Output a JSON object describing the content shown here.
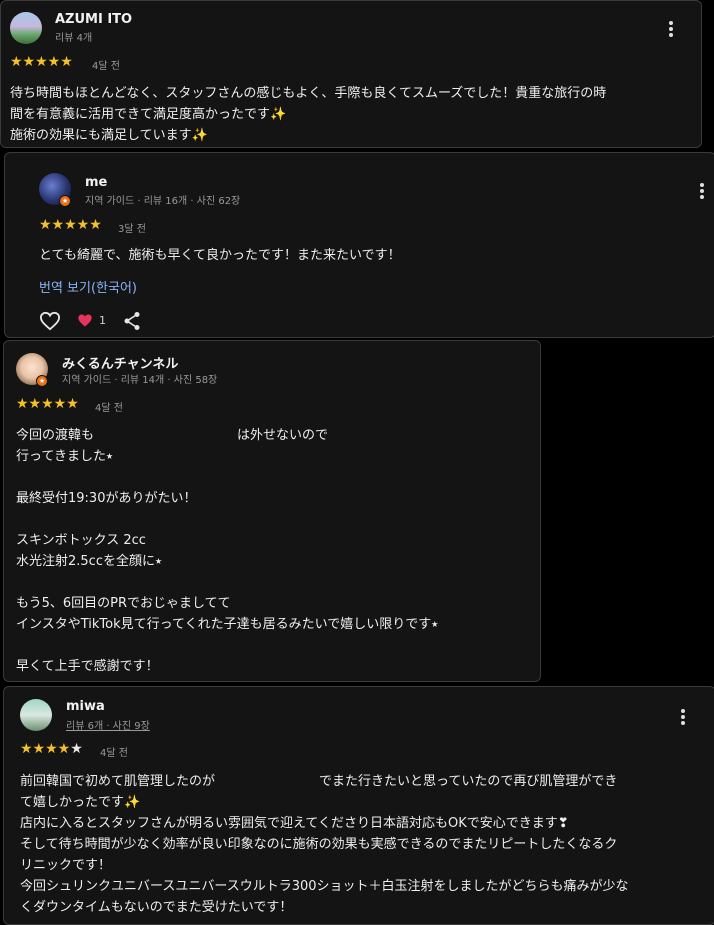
{
  "reviews": [
    {
      "name": "AZUMI ITO",
      "meta": "리뷰 4개",
      "stars": "★★★★★",
      "stars_empty": "",
      "rating": 5,
      "when": "4달 전",
      "body": "待ち時間もほとんどなく、スタッフさんの感じもよく、手際も良くてスムーズでした！貴重な旅行の時\n間を有意義に活用できて満足度高かったです✨\n施術の効果にも満足しています✨"
    },
    {
      "name": "me",
      "meta": "지역 가이드 · 리뷰 16개 · 사진 62장",
      "stars": "★★★★★",
      "stars_empty": "",
      "rating": 5,
      "when": "3달 전",
      "body": "とても綺麗で、施術も早くて良かったです！また来たいです！",
      "translate": "번역 보기(한국어)",
      "like_count": "1"
    },
    {
      "name": "みくるんチャンネル",
      "meta": "지역 가이드 · 리뷰 14개 · 사진 58장",
      "stars": "★★★★★",
      "stars_empty": "",
      "rating": 5,
      "when": "4달 전",
      "body": "今回の渡韓も　　　　　　　　　　　は外せないので\n行ってきました⭑\n\n最終受付19:30がありがたい！\n\nスキンボトックス 2cc\n水光注射2.5ccを全顔に⭑\n\nもう5、6回目のPRでおじゃましてて\nインスタやTikTok見て行ってくれた子達も居るみたいで嬉しい限りです⭑\n\n早くて上手で感謝です！"
    },
    {
      "name": "miwa",
      "meta": "리뷰 6개 · 사진 9장",
      "stars": "★★★★",
      "stars_empty": "★",
      "rating": 4,
      "when": "4달 전",
      "body": "前回韓国で初めて肌管理したのが　　　　　　　　でまた行きたいと思っていたので再び肌管理ができ\nて嬉しかったです✨\n店内に入るとスタッフさんが明るい雰囲気で迎えてくださり日本語対応もOKで安心できます❣\nそして待ち時間が少なく効率が良い印象なのに施術の効果も実感できるのでまたリピートしたくなるク\nリニックです！\n今回シュリンクユニバースユニバースウルトラ300ショット＋白玉注射をしましたがどちらも痛みが少な\nくダウンタイムもないのでまた受けたいです！"
    }
  ],
  "colors": {
    "star": "#f6c026",
    "link": "#8ab4f8",
    "heart": "#e8335a",
    "card": "#141414",
    "border": "#3a3a3a"
  },
  "icons": [
    "more-vert-icon",
    "heart-outline-icon",
    "heart-filled-icon",
    "share-icon",
    "local-guide-badge-icon"
  ]
}
